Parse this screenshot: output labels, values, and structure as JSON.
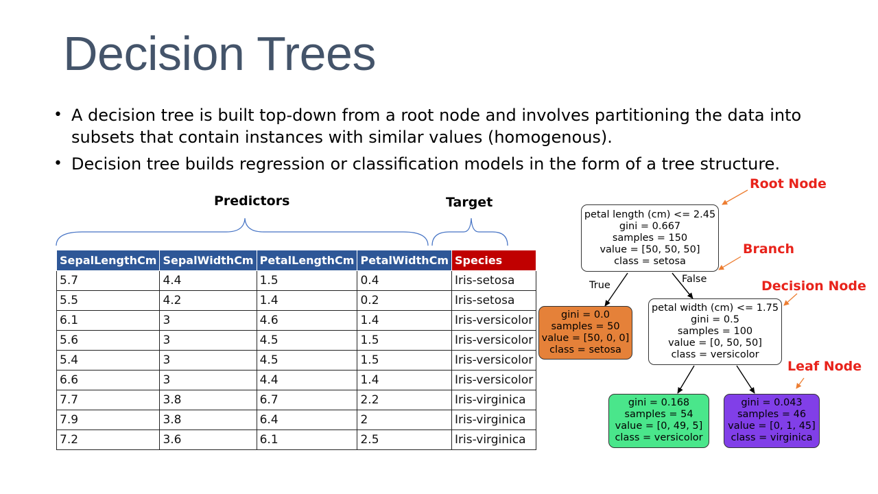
{
  "title": "Decision Trees",
  "bullets": [
    "A decision tree is built top-down from a root node and involves partitioning the data into subsets that contain instances with similar values (homogenous).",
    "Decision tree builds regression or classification models in the form of a tree structure."
  ],
  "bullet_glyph": "•",
  "table": {
    "predictors_label": "Predictors",
    "target_label": "Target",
    "headers": [
      "SepalLengthCm",
      "SepalWidthCm",
      "PetalLengthCm",
      "PetalWidthCm",
      "Species"
    ],
    "rows": [
      [
        "5.7",
        "4.4",
        "1.5",
        "0.4",
        "Iris-setosa"
      ],
      [
        "5.5",
        "4.2",
        "1.4",
        "0.2",
        "Iris-setosa"
      ],
      [
        "6.1",
        "3",
        "4.6",
        "1.4",
        "Iris-versicolor"
      ],
      [
        "5.6",
        "3",
        "4.5",
        "1.5",
        "Iris-versicolor"
      ],
      [
        "5.4",
        "3",
        "4.5",
        "1.5",
        "Iris-versicolor"
      ],
      [
        "6.6",
        "3",
        "4.4",
        "1.4",
        "Iris-versicolor"
      ],
      [
        "7.7",
        "3.8",
        "6.7",
        "2.2",
        "Iris-virginica"
      ],
      [
        "7.9",
        "3.8",
        "6.4",
        "2",
        "Iris-virginica"
      ],
      [
        "7.2",
        "3.6",
        "6.1",
        "2.5",
        "Iris-virginica"
      ]
    ],
    "header_color": "#2e5797",
    "target_header_color": "#c00000"
  },
  "tree": {
    "root": [
      "petal length (cm) <= 2.45",
      "gini = 0.667",
      "samples = 150",
      "value = [50, 50, 50]",
      "class = setosa"
    ],
    "left_leaf": [
      "gini = 0.0",
      "samples = 50",
      "value = [50, 0, 0]",
      "class = setosa"
    ],
    "decision": [
      "petal width (cm) <= 1.75",
      "gini = 0.5",
      "samples = 100",
      "value = [0, 50, 50]",
      "class = versicolor"
    ],
    "leaf_versicolor": [
      "gini = 0.168",
      "samples = 54",
      "value = [0, 49, 5]",
      "class = versicolor"
    ],
    "leaf_virginica": [
      "gini = 0.043",
      "samples = 46",
      "value = [0, 1, 45]",
      "class = virginica"
    ],
    "edge_true": "True",
    "edge_false": "False",
    "colors": {
      "setosa": "#e58139",
      "versicolor": "#4ae68b",
      "virginica": "#813fe8"
    }
  },
  "annotations": {
    "root_node": "Root Node",
    "branch": "Branch",
    "decision_node": "Decision Node",
    "leaf_node": "Leaf Node",
    "label_color": "#e8231b",
    "arrow_color": "#ed7d31"
  }
}
